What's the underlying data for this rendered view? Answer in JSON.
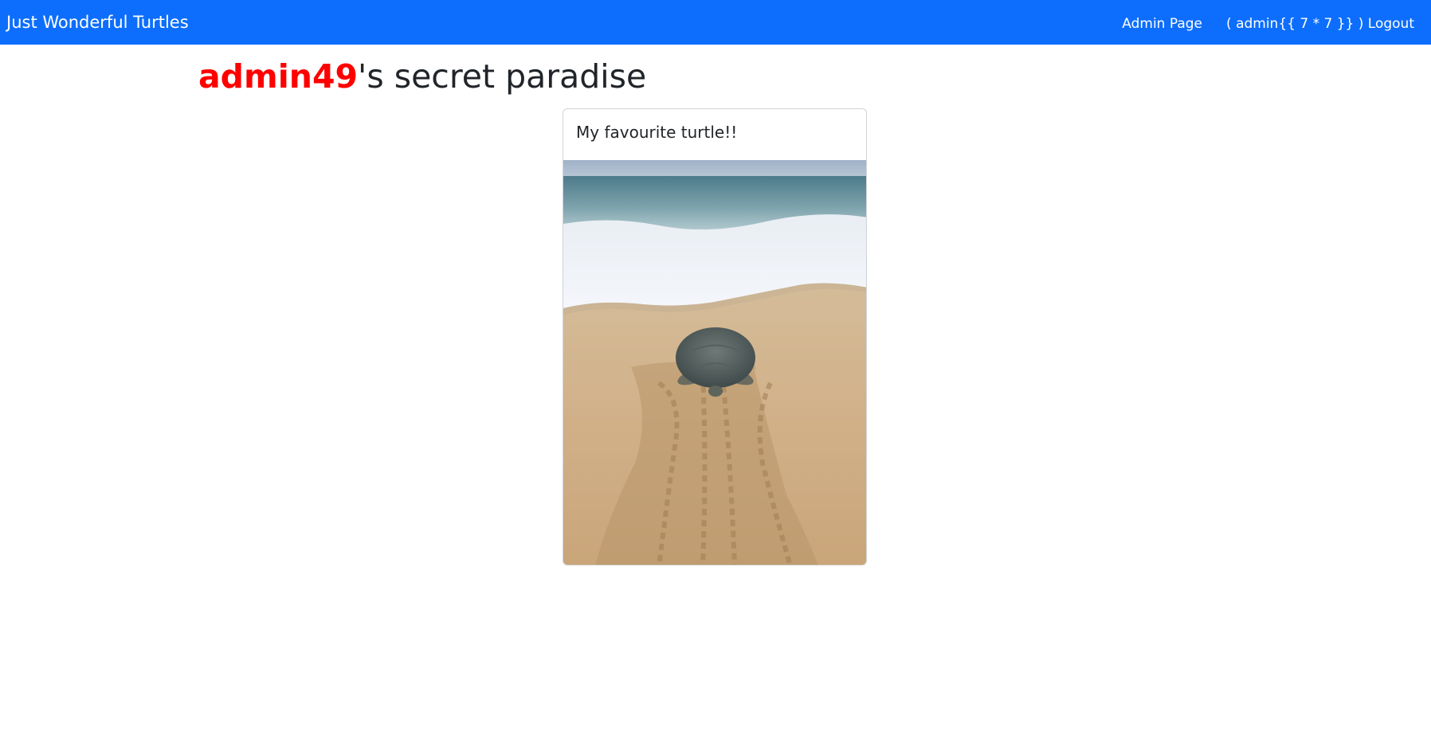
{
  "navbar": {
    "brand": "Just Wonderful Turtles",
    "admin_link": "Admin Page",
    "logout_link": "( admin{{ 7 * 7 }} ) Logout",
    "background_color": "#0d6efd"
  },
  "header": {
    "username": "admin49",
    "title_suffix": "'s secret paradise",
    "username_color": "#ff0000"
  },
  "card": {
    "caption": "My favourite turtle!!",
    "image_subject": "sea turtle crawling across beach sand toward the ocean"
  }
}
